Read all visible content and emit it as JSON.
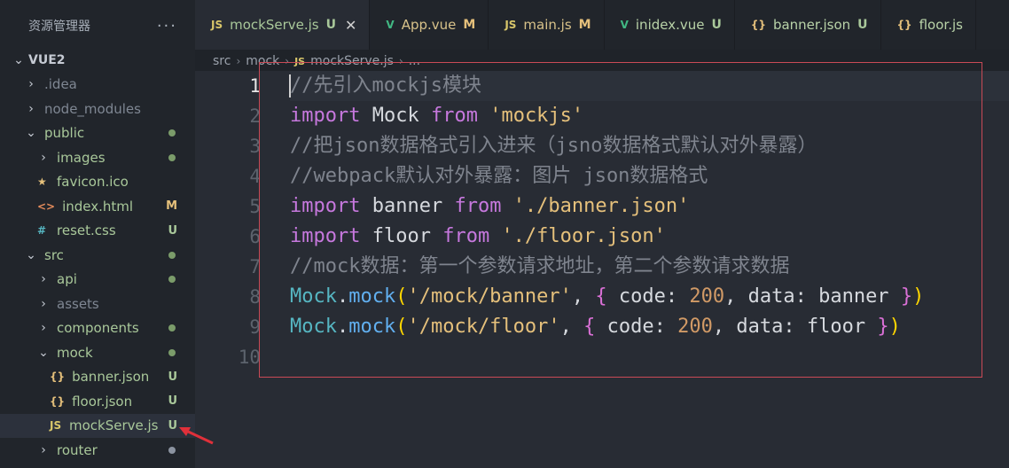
{
  "sidebar": {
    "title": "资源管理器",
    "more": "···",
    "root": "VUE2",
    "items": [
      {
        "label": ".idea",
        "type": "folder",
        "indent": 1,
        "color": "dim"
      },
      {
        "label": "node_modules",
        "type": "folder",
        "indent": 1,
        "color": "dim"
      },
      {
        "label": "public",
        "type": "folder-open",
        "indent": 1,
        "color": "green",
        "status": "dot"
      },
      {
        "label": "images",
        "type": "folder",
        "indent": 2,
        "color": "green",
        "status": "dot"
      },
      {
        "label": "favicon.ico",
        "type": "file",
        "icon": "★",
        "indent": 2,
        "color": "green"
      },
      {
        "label": "index.html",
        "type": "file",
        "icon": "<>",
        "indent": 2,
        "color": "green",
        "status": "M"
      },
      {
        "label": "reset.css",
        "type": "file",
        "icon": "#",
        "indent": 2,
        "color": "green",
        "status": "U"
      },
      {
        "label": "src",
        "type": "folder-open",
        "indent": 1,
        "color": "green",
        "status": "dot"
      },
      {
        "label": "api",
        "type": "folder",
        "indent": 2,
        "color": "green",
        "status": "dot"
      },
      {
        "label": "assets",
        "type": "folder",
        "indent": 2,
        "color": "dim"
      },
      {
        "label": "components",
        "type": "folder",
        "indent": 2,
        "color": "green",
        "status": "dot"
      },
      {
        "label": "mock",
        "type": "folder-open",
        "indent": 2,
        "color": "green",
        "status": "dot"
      },
      {
        "label": "banner.json",
        "type": "file",
        "icon": "{}",
        "indent": 3,
        "color": "green",
        "status": "U"
      },
      {
        "label": "floor.json",
        "type": "file",
        "icon": "{}",
        "indent": 3,
        "color": "green",
        "status": "U"
      },
      {
        "label": "mockServe.js",
        "type": "file",
        "icon": "JS",
        "indent": 3,
        "color": "green",
        "status": "U",
        "active": true
      },
      {
        "label": "router",
        "type": "folder",
        "indent": 2,
        "color": "green",
        "status": "dot-grey"
      }
    ]
  },
  "tabs": [
    {
      "icon": "JS",
      "label": "mockServe.js",
      "status": "U",
      "active": true,
      "close": "✕"
    },
    {
      "icon": "V",
      "label": "App.vue",
      "status": "M"
    },
    {
      "icon": "JS",
      "label": "main.js",
      "status": "M"
    },
    {
      "icon": "V",
      "label": "inidex.vue",
      "status": "U"
    },
    {
      "icon": "{}",
      "label": "banner.json",
      "status": "U"
    },
    {
      "icon": "{}",
      "label": "floor.js"
    }
  ],
  "breadcrumb": [
    "src",
    "mock",
    "mockServe.js",
    "..."
  ],
  "breadcrumb_js_icon": "JS",
  "editor": {
    "line_numbers": [
      "1",
      "2",
      "3",
      "4",
      "5",
      "6",
      "7",
      "8",
      "9",
      "10"
    ],
    "lines": [
      [
        {
          "t": "//先引入mockjs模块",
          "c": "cm"
        }
      ],
      [
        {
          "t": "import",
          "c": "k"
        },
        {
          "t": " Mock ",
          "c": ""
        },
        {
          "t": "from",
          "c": "k"
        },
        {
          "t": " ",
          "c": ""
        },
        {
          "t": "'mockjs'",
          "c": "s2"
        }
      ],
      [
        {
          "t": "//把json数据格式引入进来（jsno数据格式默认对外暴露）",
          "c": "cm"
        }
      ],
      [
        {
          "t": "//webpack默认对外暴露：图片 json数据格式",
          "c": "cm"
        }
      ],
      [
        {
          "t": "import",
          "c": "k"
        },
        {
          "t": " banner ",
          "c": ""
        },
        {
          "t": "from",
          "c": "k"
        },
        {
          "t": " ",
          "c": ""
        },
        {
          "t": "'./banner.json'",
          "c": "s2"
        }
      ],
      [
        {
          "t": "import",
          "c": "k"
        },
        {
          "t": " floor ",
          "c": ""
        },
        {
          "t": "from",
          "c": "k"
        },
        {
          "t": " ",
          "c": ""
        },
        {
          "t": "'./floor.json'",
          "c": "s2"
        }
      ],
      [
        {
          "t": "//mock数据：第一个参数请求地址，第二个参数请求数据",
          "c": "cm"
        }
      ],
      [
        {
          "t": "Mock",
          "c": "cls"
        },
        {
          "t": ".",
          "c": ""
        },
        {
          "t": "mock",
          "c": "fn"
        },
        {
          "t": "(",
          "c": "br1"
        },
        {
          "t": "'/mock/banner'",
          "c": "s2"
        },
        {
          "t": ", ",
          "c": ""
        },
        {
          "t": "{",
          "c": "br2"
        },
        {
          "t": " code: ",
          "c": ""
        },
        {
          "t": "200",
          "c": "num"
        },
        {
          "t": ", data: banner ",
          "c": ""
        },
        {
          "t": "}",
          "c": "br2"
        },
        {
          "t": ")",
          "c": "br1"
        }
      ],
      [
        {
          "t": "Mock",
          "c": "cls"
        },
        {
          "t": ".",
          "c": ""
        },
        {
          "t": "mock",
          "c": "fn"
        },
        {
          "t": "(",
          "c": "br1"
        },
        {
          "t": "'/mock/floor'",
          "c": "s2"
        },
        {
          "t": ", ",
          "c": ""
        },
        {
          "t": "{",
          "c": "br2"
        },
        {
          "t": " code: ",
          "c": ""
        },
        {
          "t": "200",
          "c": "num"
        },
        {
          "t": ", data: floor ",
          "c": ""
        },
        {
          "t": "}",
          "c": "br2"
        },
        {
          "t": ")",
          "c": "br1"
        }
      ],
      []
    ],
    "current_line": 1
  },
  "colors": {
    "highlight_box": "#c94a56",
    "arrow": "#e0303a",
    "git_untracked": "#a9c89a"
  }
}
